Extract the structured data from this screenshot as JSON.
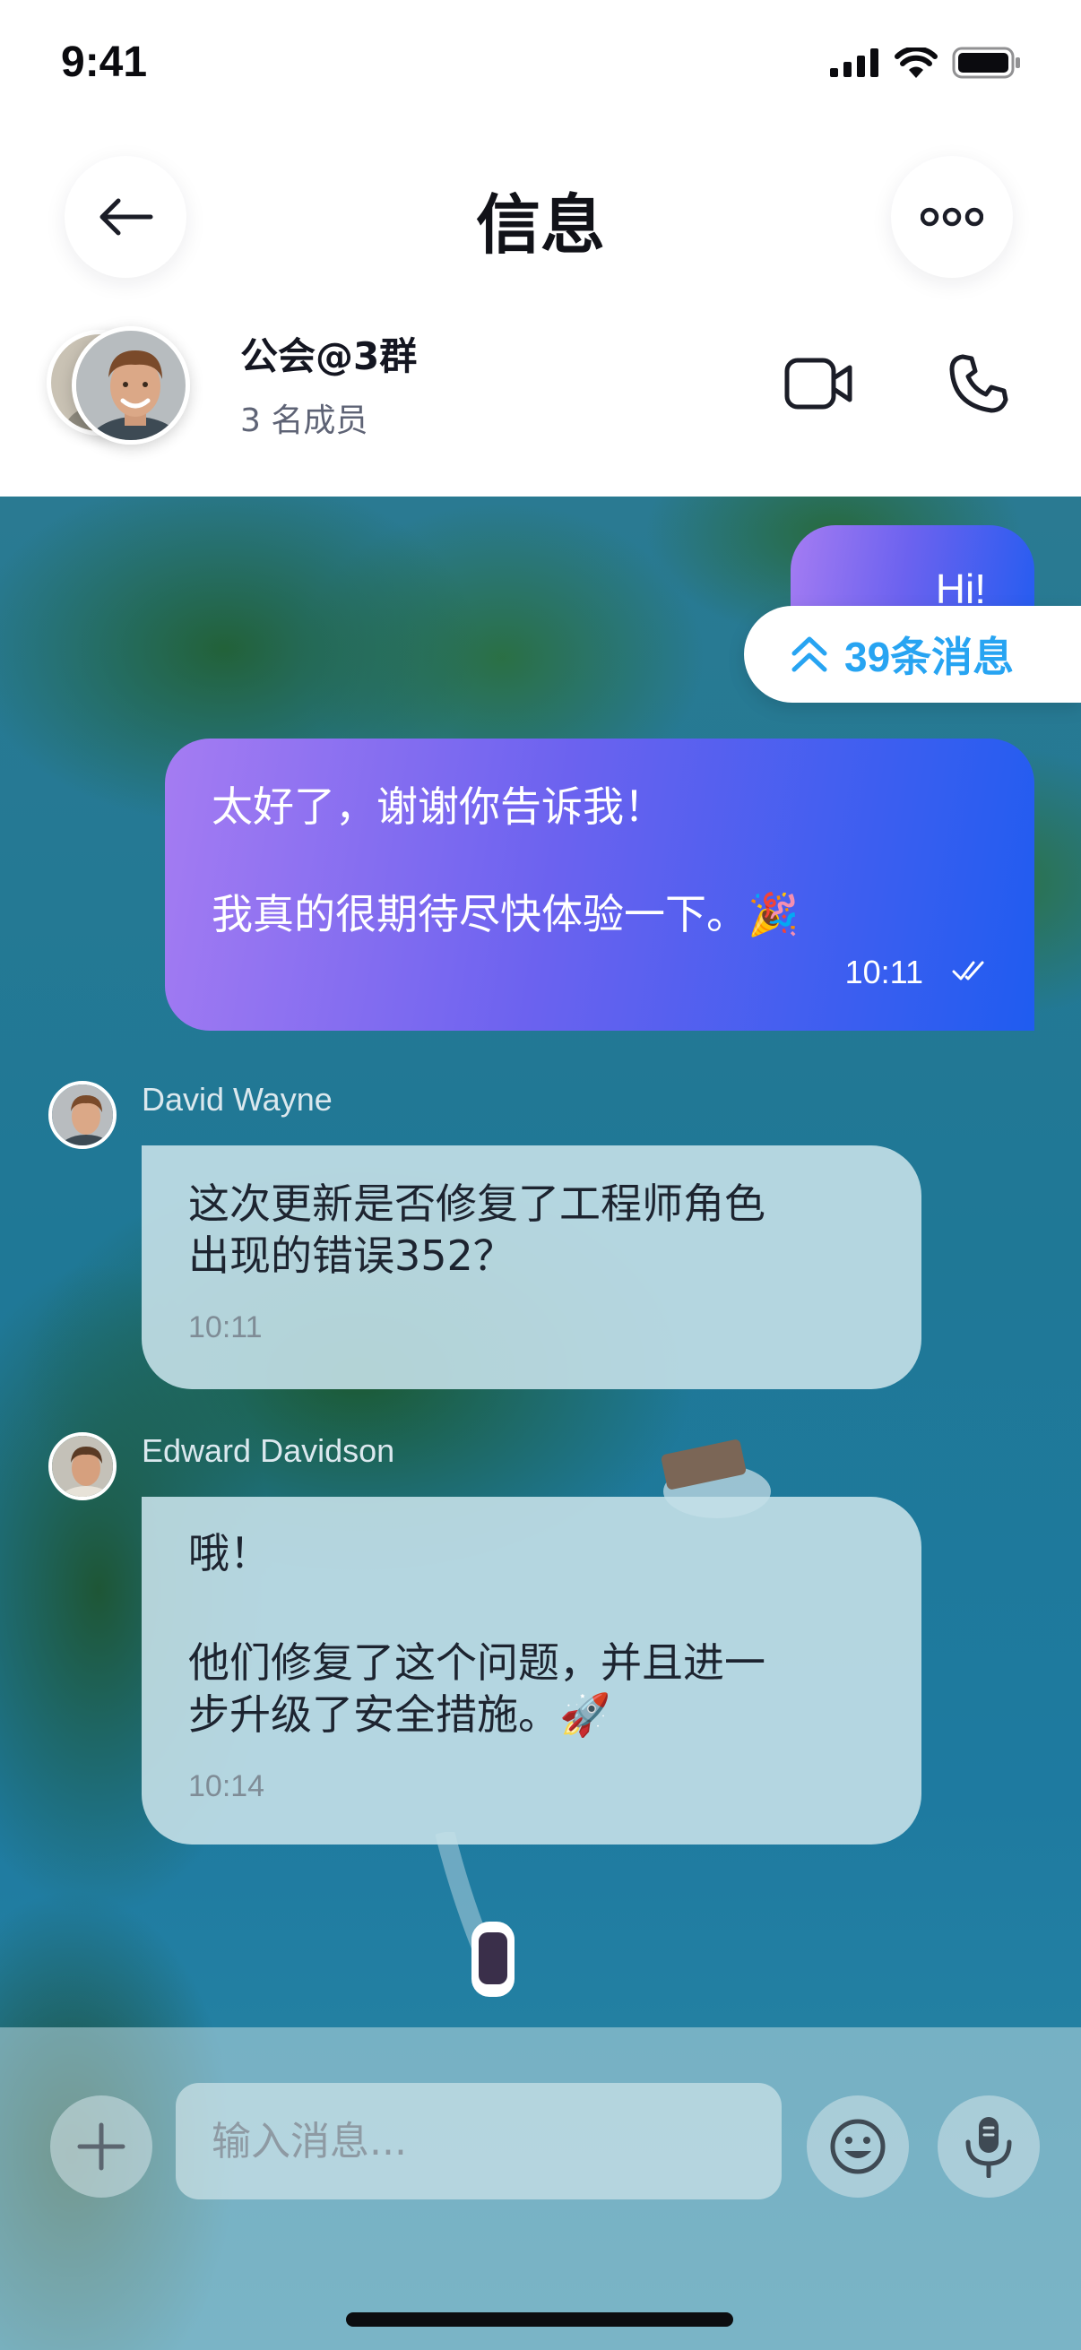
{
  "status_bar": {
    "time": "9:41"
  },
  "header": {
    "title": "信息"
  },
  "group": {
    "name": "公会@3群",
    "members": "3 名成员"
  },
  "new_messages": {
    "label": "39条消息"
  },
  "messages": [
    {
      "direction": "out",
      "text": "Hi!"
    },
    {
      "direction": "out",
      "lines": [
        "太好了，谢谢你告诉我！",
        "我真的很期待尽快体验一下。🎉"
      ],
      "time": "10:11",
      "status": "read"
    },
    {
      "direction": "in",
      "sender": "David Wayne",
      "lines": [
        "这次更新是否修复了工程师角色",
        "出现的错误352？"
      ],
      "time": "10:11"
    },
    {
      "direction": "in",
      "sender": "Edward Davidson",
      "lines": [
        "哦！",
        "他们修复了这个问题，并且进一",
        "步升级了安全措施。🚀"
      ],
      "time": "10:14"
    }
  ],
  "composer": {
    "placeholder": "输入消息..."
  },
  "icons": {
    "back": "arrow-left-icon",
    "more": "more-dots-icon",
    "video": "video-camera-icon",
    "phone": "phone-icon",
    "scroll_up": "double-chevron-up-icon",
    "read": "double-check-icon",
    "add": "plus-icon",
    "emoji": "smile-icon",
    "mic": "microphone-icon"
  },
  "colors": {
    "outgoing_gradient_start": "#a57cf2",
    "outgoing_gradient_end": "#1f5cf0",
    "accent_blue": "#27a4f2",
    "incoming_bubble": "#c4e0e8"
  }
}
